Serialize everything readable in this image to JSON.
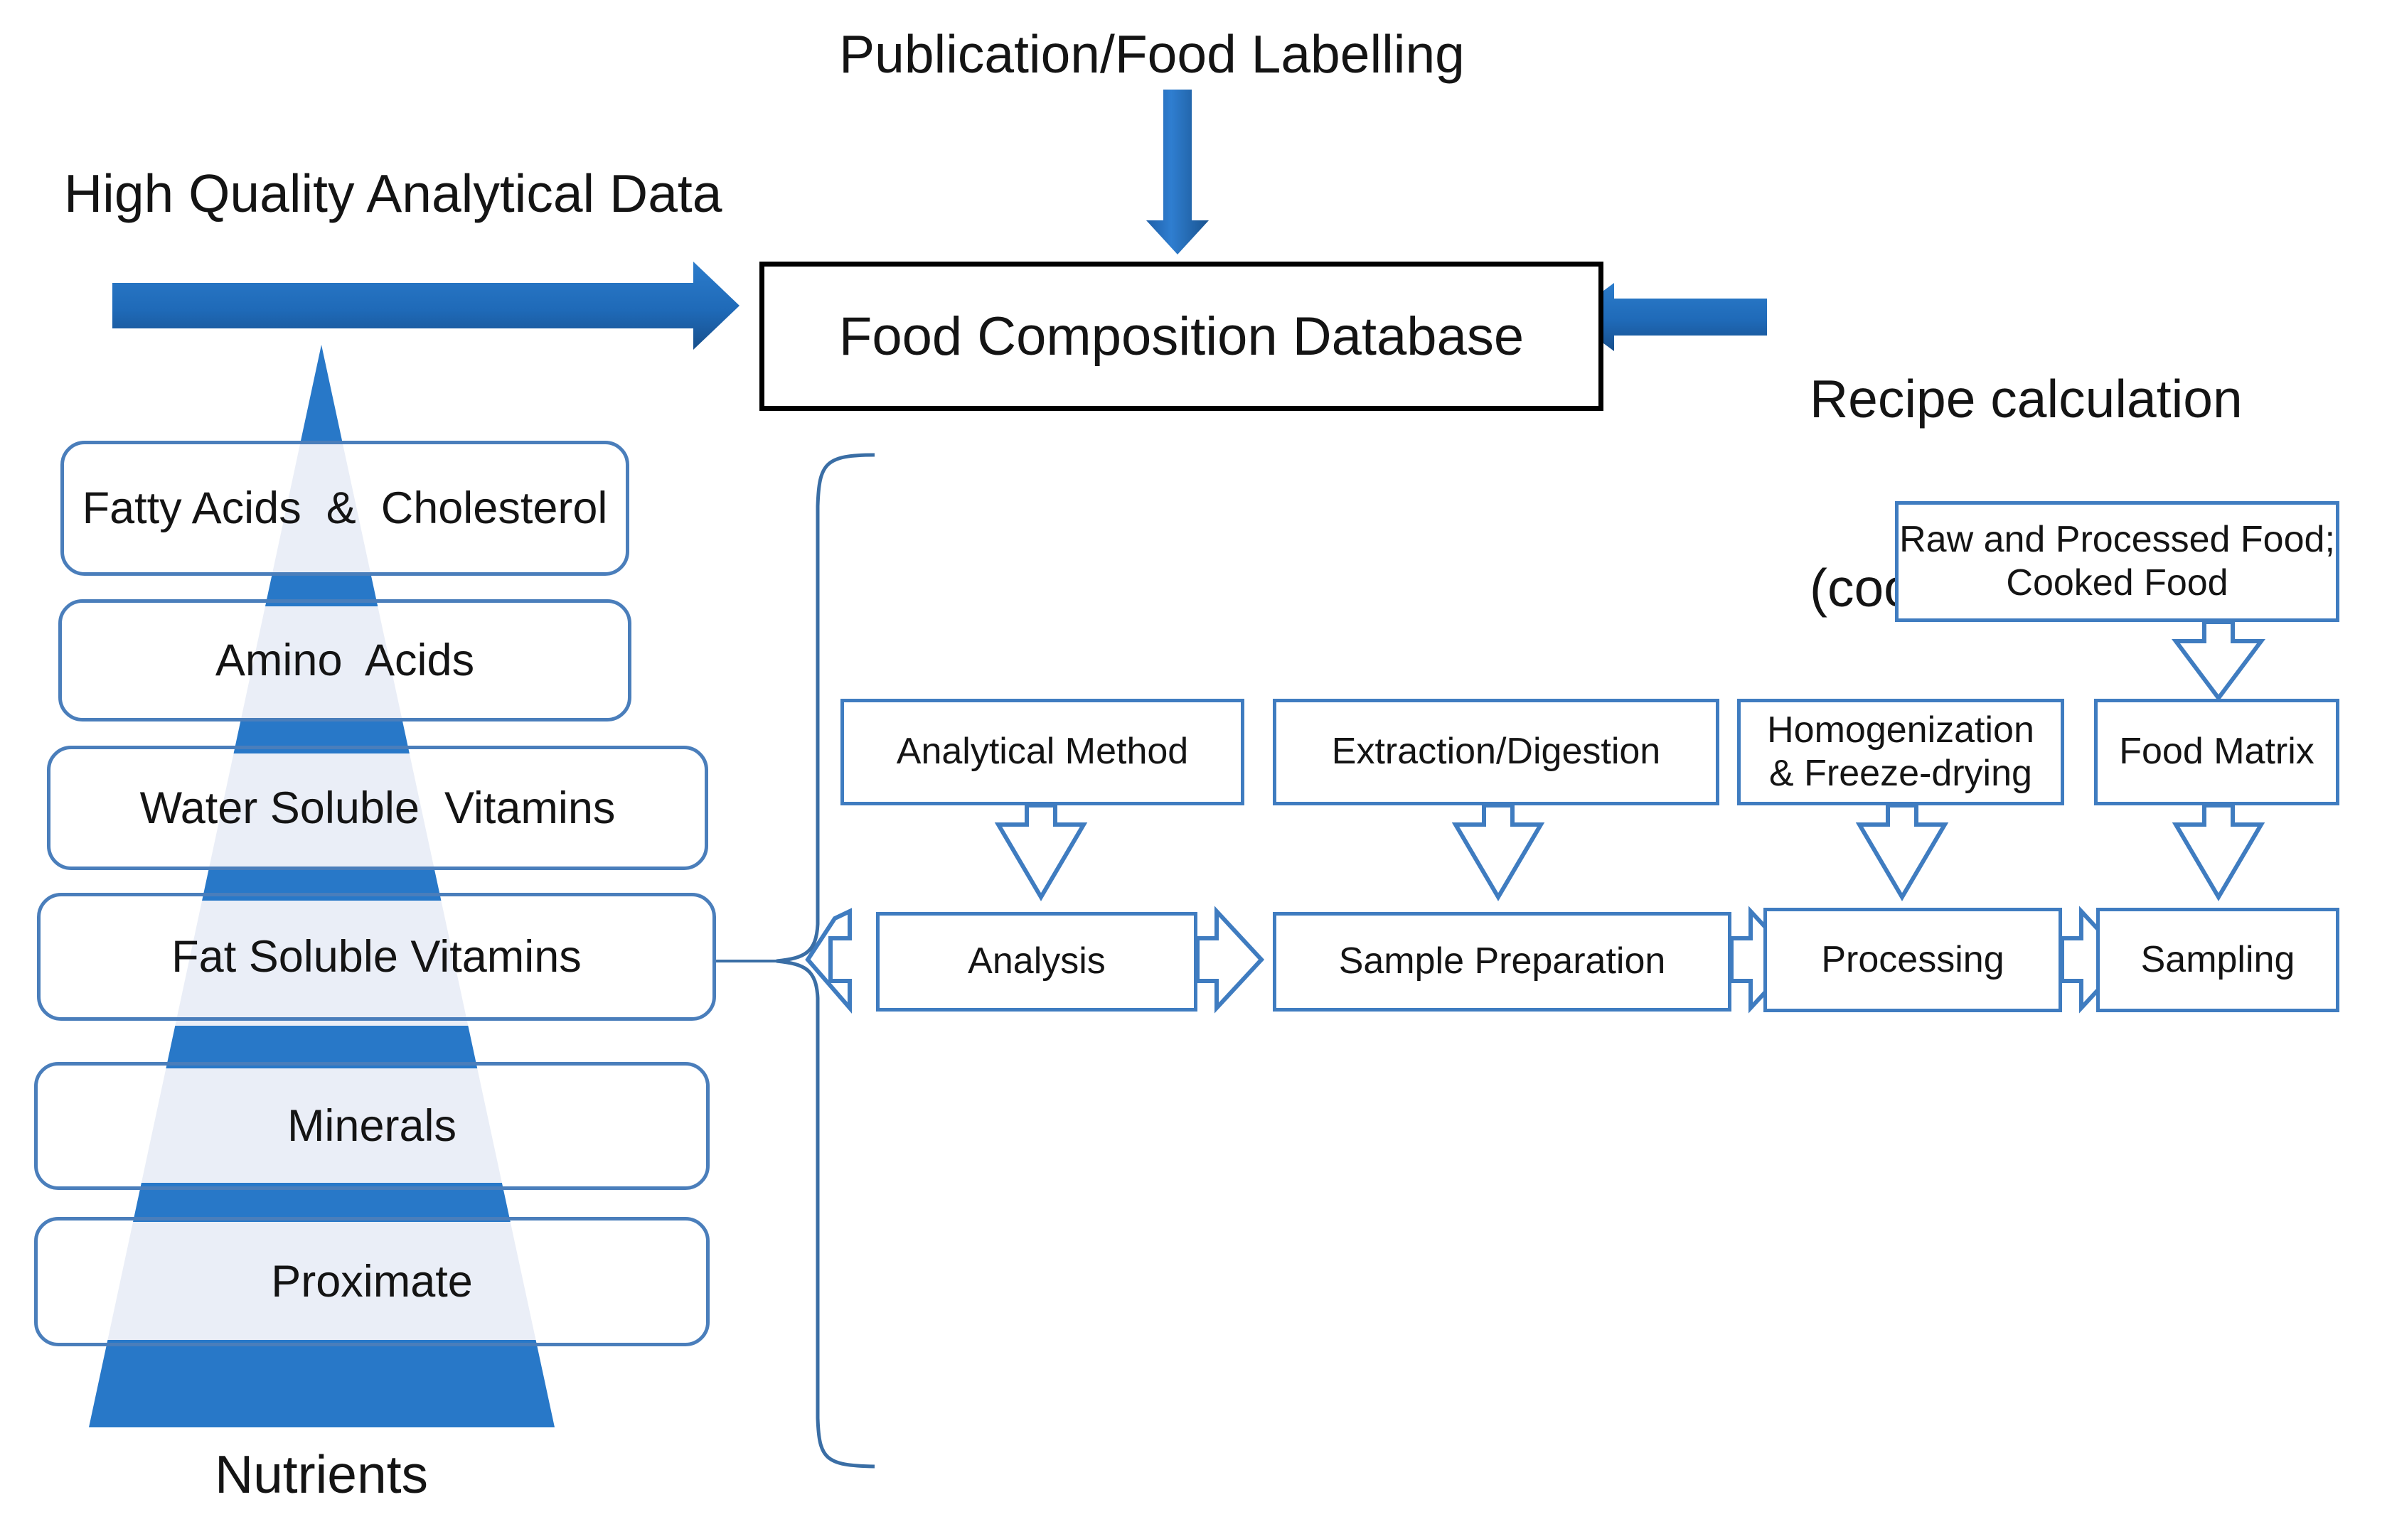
{
  "diagram": {
    "title_texts": {
      "publication": "Publication/Food Labelling",
      "high_quality": "High Quality Analytical Data",
      "recipe_line1": "Recipe calculation",
      "recipe_line2": "(cooked food)",
      "nutrients": "Nutrients"
    },
    "central_box": {
      "label": "Food Composition Database"
    },
    "nutrient_pyramid": {
      "caption": "Nutrients",
      "levels": [
        {
          "label": "Fatty Acids  &  Cholesterol"
        },
        {
          "label": "Amino  Acids"
        },
        {
          "label": "Water Soluble  Vitamins"
        },
        {
          "label": "Fat Soluble Vitamins"
        },
        {
          "label": "Minerals"
        },
        {
          "label": "Proximate"
        }
      ]
    },
    "workflow": {
      "source_box": {
        "line1": "Raw and Processed Food;",
        "line2": "Cooked Food"
      },
      "top_row": [
        {
          "line1": "Analytical Method",
          "line2": ""
        },
        {
          "line1": "Extraction/Digestion",
          "line2": ""
        },
        {
          "line1": "Homogenization",
          "line2": "& Freeze-drying"
        },
        {
          "line1": "Food Matrix",
          "line2": ""
        }
      ],
      "bottom_row": [
        {
          "label": "Analysis"
        },
        {
          "label": "Sample Preparation"
        },
        {
          "label": "Processing"
        },
        {
          "label": "Sampling"
        }
      ]
    },
    "colors": {
      "accent_blue": "#2878c8",
      "box_border_blue": "#3f7cc0",
      "nutrient_border_blue": "#4a7ebb",
      "pyramid_pale": "#eaeef7",
      "black": "#000000"
    }
  }
}
